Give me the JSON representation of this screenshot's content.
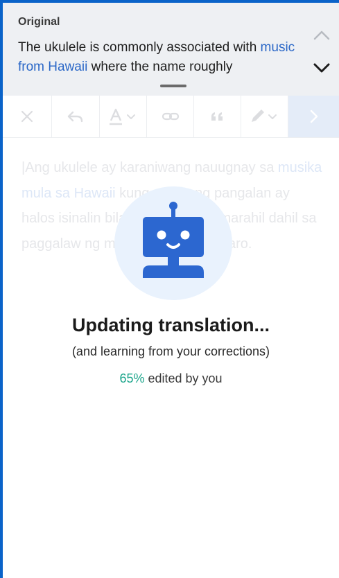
{
  "original": {
    "label": "Original",
    "text_before_link": "The ukulele is commonly associated with ",
    "link_text": "music from Hawaii",
    "text_after_link": " where the name roughly"
  },
  "toolbar": {
    "icons": [
      "close-icon",
      "undo-icon",
      "text-format-icon",
      "link-icon",
      "quote-icon",
      "pen-icon",
      "next-icon"
    ]
  },
  "editor": {
    "text_before_link": "|Ang ukulele ay karaniwang nauugnay sa ",
    "link_text": "musika mula sa Hawaii",
    "text_after_link": " kung saan ang pangalan ay halos isinalin bilang \"jump flea\", marahil dahil sa paggalaw ng mga daliri ng manlalaro."
  },
  "status": {
    "title": "Updating translation...",
    "subtitle": "(and learning from your corrections)",
    "percent": "65%",
    "percent_suffix": " edited by you",
    "percent_value": 65
  },
  "colors": {
    "frame_border": "#0a63c9",
    "robot": "#2c67d0",
    "accent_green": "#1aa48a",
    "link_blue": "#2a67c7"
  }
}
